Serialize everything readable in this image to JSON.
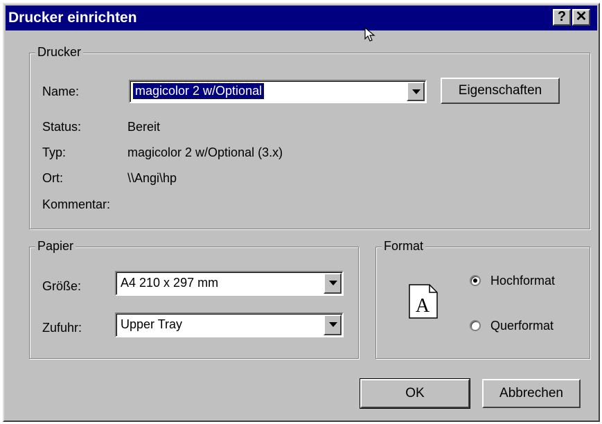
{
  "window": {
    "title": "Drucker einrichten",
    "help_label": "?",
    "close_label": "✕"
  },
  "printer": {
    "group_title": "Drucker",
    "name_label": "Name:",
    "name_value": "magicolor 2 w/Optional",
    "properties_button": "Eigenschaften",
    "status_label": "Status:",
    "status_value": "Bereit",
    "type_label": "Typ:",
    "type_value": "magicolor 2 w/Optional (3.x)",
    "location_label": "Ort:",
    "location_value": "\\\\Angi\\hp",
    "comment_label": "Kommentar:",
    "comment_value": ""
  },
  "paper": {
    "group_title": "Papier",
    "size_label": "Größe:",
    "size_value": "A4 210 x 297 mm",
    "source_label": "Zufuhr:",
    "source_value": "Upper Tray"
  },
  "orientation": {
    "group_title": "Format",
    "icon_letter": "A",
    "portrait_label": "Hochformat",
    "landscape_label": "Querformat",
    "selected": "portrait"
  },
  "buttons": {
    "ok": "OK",
    "cancel": "Abbrechen"
  },
  "colors": {
    "titlebar": "#000080",
    "face": "#c0c0c0",
    "selection": "#000080"
  }
}
